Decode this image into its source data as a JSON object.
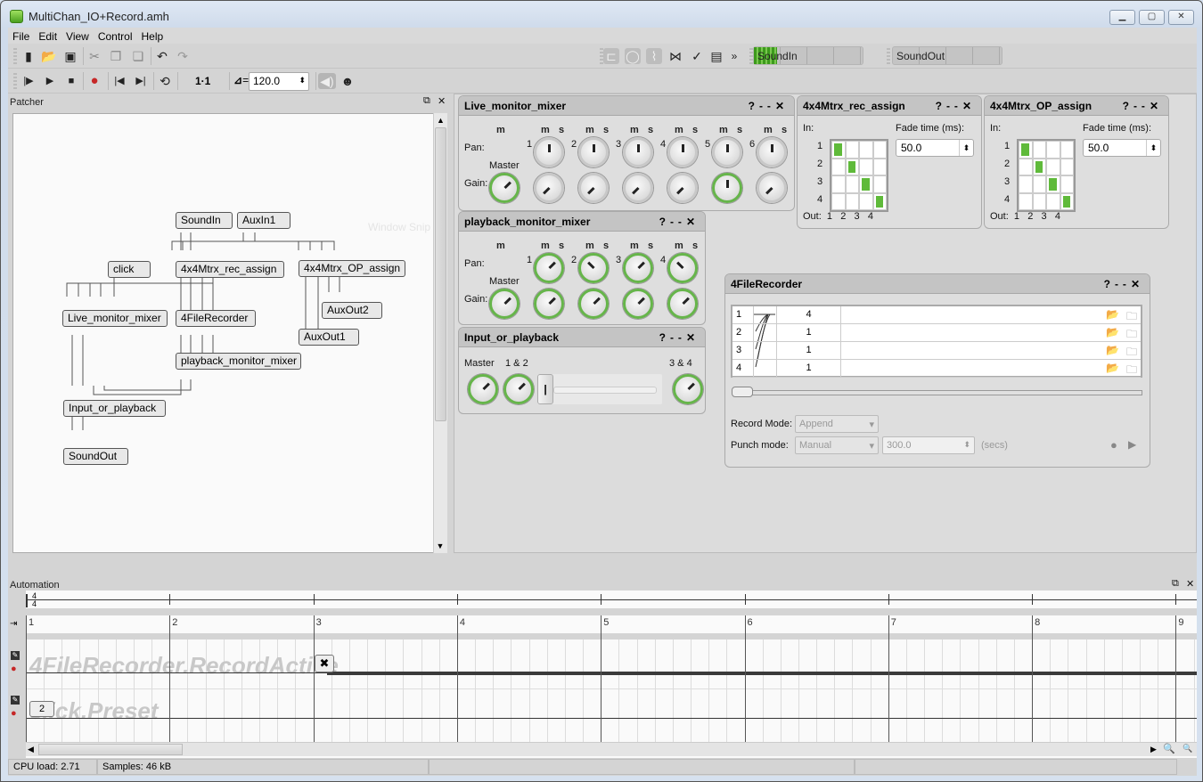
{
  "window": {
    "title": "MultiChan_IO+Record.amh",
    "controls": [
      "minimize",
      "maximize",
      "close"
    ]
  },
  "menu": [
    "File",
    "Edit",
    "View",
    "Control",
    "Help"
  ],
  "file_toolbar": {
    "icons": [
      "new-file-icon",
      "open-folder-icon",
      "save-icon",
      "cut-icon",
      "copy-icon",
      "paste-icon",
      "undo-icon",
      "redo-icon"
    ]
  },
  "transport": {
    "icons": [
      "play-from-start-icon",
      "play-icon",
      "stop-icon",
      "record-icon",
      "rewind-icon",
      "fast-forward-icon",
      "loop-icon"
    ],
    "position": "1·1",
    "tempo_label": "=",
    "tempo": "120.0"
  },
  "view_toolbar": {
    "icons": [
      "patcher-view-icon",
      "knob-view-icon",
      "automation-view-icon",
      "graph-icon",
      "settings-check-icon",
      "notes-icon"
    ],
    "overflow": "»"
  },
  "meters": [
    {
      "label": "SoundIn",
      "level": 0.25
    },
    {
      "label": "SoundOut",
      "level": 0
    }
  ],
  "patcher": {
    "title": "Patcher",
    "ghost_text": "Window Snip",
    "nodes": [
      {
        "label": "SoundIn"
      },
      {
        "label": "AuxIn1"
      },
      {
        "label": "click"
      },
      {
        "label": "4x4Mtrx_rec_assign"
      },
      {
        "label": "4x4Mtrx_OP_assign"
      },
      {
        "label": "Live_monitor_mixer"
      },
      {
        "label": "4FileRecorder"
      },
      {
        "label": "AuxOut2"
      },
      {
        "label": "AuxOut1"
      },
      {
        "label": "playback_monitor_mixer"
      },
      {
        "label": "Input_or_playback"
      },
      {
        "label": "SoundOut"
      }
    ]
  },
  "panel_controls": {
    "help": "?",
    "minimize": "--",
    "close": "✕"
  },
  "live_mixer": {
    "title": "Live_monitor_mixer",
    "mute": "m",
    "solo": "s",
    "pan_label": "Pan:",
    "gain_label": "Gain:",
    "master_label": "Master",
    "channels": [
      "1",
      "2",
      "3",
      "4",
      "5",
      "6"
    ]
  },
  "playback_mixer": {
    "title": "playback_monitor_mixer",
    "mute": "m",
    "solo": "s",
    "pan_label": "Pan:",
    "gain_label": "Gain:",
    "master_label": "Master",
    "channels": [
      "1",
      "2",
      "3",
      "4"
    ]
  },
  "input_or_playback": {
    "title": "Input_or_playback",
    "master_label": "Master",
    "label_12": "1 & 2",
    "label_34": "3 & 4",
    "crossfade": 0
  },
  "rec_assign": {
    "title": "4x4Mtrx_rec_assign",
    "in_label": "In:",
    "out_label": "Out:",
    "rows": [
      "1",
      "2",
      "3",
      "4"
    ],
    "cols": [
      "1",
      "2",
      "3",
      "4"
    ],
    "fade_label": "Fade time (ms):",
    "fade_value": "50.0"
  },
  "op_assign": {
    "title": "4x4Mtrx_OP_assign",
    "in_label": "In:",
    "out_label": "Out:",
    "rows": [
      "1",
      "2",
      "3",
      "4"
    ],
    "cols": [
      "1",
      "2",
      "3",
      "4"
    ],
    "fade_label": "Fade time (ms):",
    "fade_value": "50.0"
  },
  "recorder": {
    "title": "4FileRecorder",
    "tracks": [
      {
        "num": "1",
        "channel": "4"
      },
      {
        "num": "2",
        "channel": "1"
      },
      {
        "num": "3",
        "channel": "1"
      },
      {
        "num": "4",
        "channel": "1"
      }
    ],
    "record_mode_label": "Record Mode:",
    "record_mode": "Append",
    "punch_mode_label": "Punch mode:",
    "punch_mode": "Manual",
    "punch_time": "300.0",
    "punch_unit": "(secs)"
  },
  "automation": {
    "title": "Automation",
    "time_sig_top": "4",
    "time_sig_bottom": "4",
    "bars": [
      "1",
      "2",
      "3",
      "4",
      "5",
      "6",
      "7",
      "8",
      "9"
    ],
    "tracks": [
      {
        "name": "4FileRecorder.RecordActive"
      },
      {
        "name": "click.Preset",
        "value": "2"
      }
    ],
    "marker_icon": "✖"
  },
  "statusbar": {
    "cpu": "CPU load: 2.71",
    "samples": "Samples: 46 kB"
  }
}
